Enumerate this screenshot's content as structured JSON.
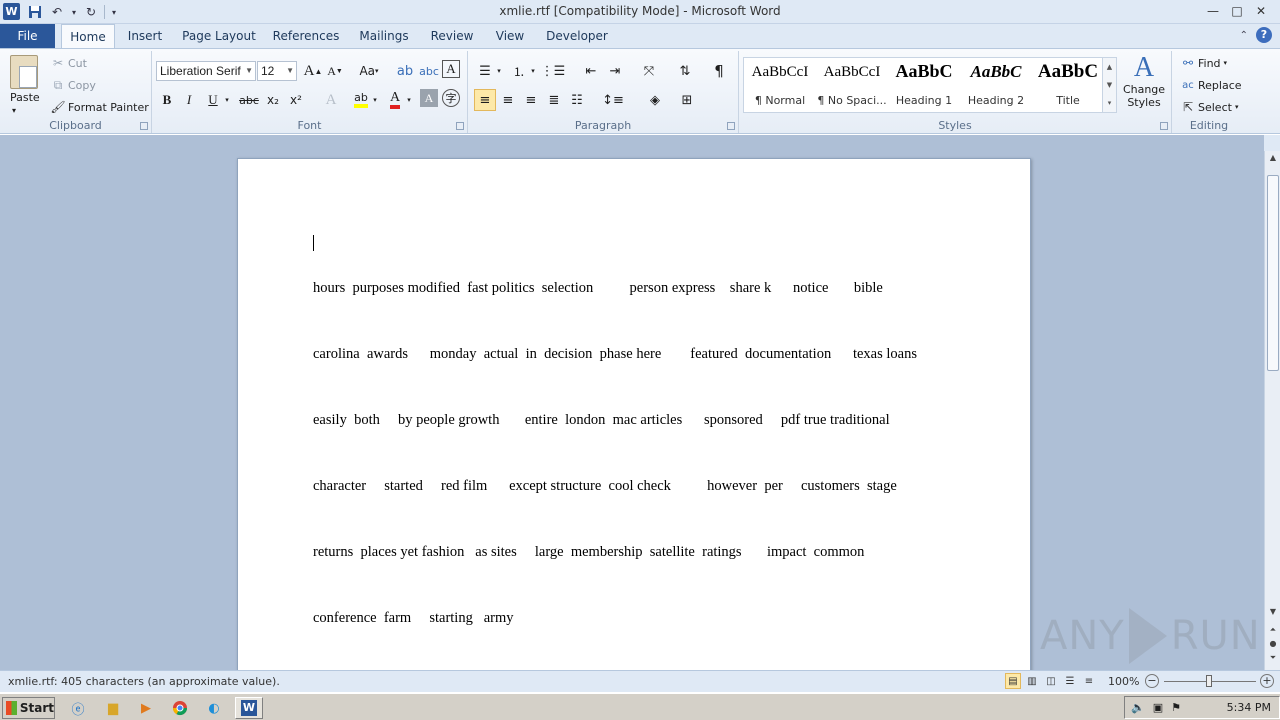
{
  "window": {
    "title": "xmlie.rtf [Compatibility Mode] - Microsoft Word",
    "app_icon": "W",
    "controls": {
      "minimize": "—",
      "maximize": "□",
      "close": "✕"
    }
  },
  "tabs": [
    "File",
    "Home",
    "Insert",
    "Page Layout",
    "References",
    "Mailings",
    "Review",
    "View",
    "Developer"
  ],
  "active_tab": "Home",
  "clipboard": {
    "paste": "Paste",
    "cut": "Cut",
    "copy": "Copy",
    "format_painter": "Format Painter",
    "label": "Clipboard"
  },
  "font": {
    "name": "Liberation Serif",
    "size": "12",
    "label": "Font",
    "bold": "B",
    "italic": "I",
    "underline": "U",
    "strike": "abc",
    "subscript": "x₂",
    "superscript": "x²",
    "grow": "A",
    "shrink": "A",
    "change_case": "Aa",
    "font_color_glyph": "A",
    "highlight_glyph": "ab"
  },
  "paragraph": {
    "label": "Paragraph",
    "pilcrow": "¶"
  },
  "styles": {
    "label": "Styles",
    "items": [
      {
        "sample": "AaBbCcI",
        "name": "¶ Normal"
      },
      {
        "sample": "AaBbCcI",
        "name": "¶ No Spaci..."
      },
      {
        "sample": "AaBbC",
        "name": "Heading 1"
      },
      {
        "sample": "AaBbC",
        "name": "Heading 2"
      },
      {
        "sample": "AaBbC",
        "name": "Title"
      }
    ],
    "change_styles": "Change Styles"
  },
  "editing": {
    "label": "Editing",
    "find": "Find",
    "replace": "Replace",
    "select": "Select"
  },
  "document": {
    "lines": [
      "hours  purposes modified  fast politics  selection          person express    share k      notice       bible",
      "carolina  awards      monday  actual  in  decision  phase here        featured  documentation      texas loans",
      "easily  both     by people growth       entire  london  mac articles      sponsored     pdf true traditional",
      "character     started     red film      except structure  cool check          however  per     customers  stage",
      "returns  places yet fashion   as sites     large  membership  satellite  ratings       impact  common",
      "conference  farm     starting   army"
    ]
  },
  "statusbar": {
    "text": "xmlie.rtf: 405 characters (an approximate value).",
    "zoom": "100%",
    "zoom_value": 100
  },
  "watermark": {
    "left": "ANY",
    "right": "RUN"
  },
  "taskbar": {
    "start": "Start",
    "clock": "5:34 PM"
  }
}
